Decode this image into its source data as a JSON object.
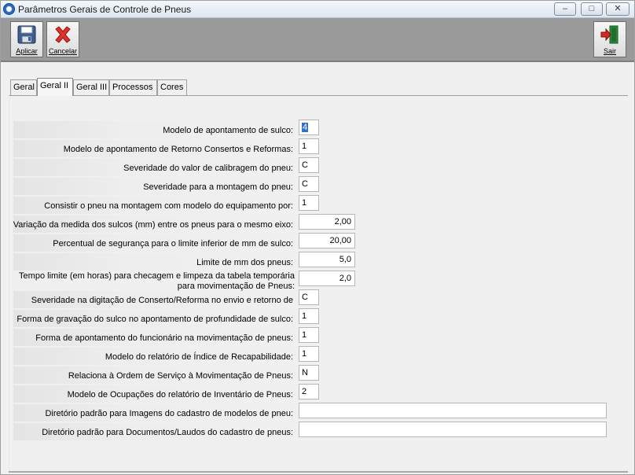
{
  "window": {
    "title": "Parâmetros Gerais de Controle de Pneus",
    "controls": {
      "minimize": "–",
      "maximize": "□",
      "close": "✕"
    }
  },
  "toolbar": {
    "aplicar_label": "Aplicar",
    "cancelar_label": "Cancelar",
    "sair_label": "Sair"
  },
  "tabs": [
    "Geral",
    "Geral II",
    "Geral III",
    "Processos",
    "Cores"
  ],
  "active_tab": "Geral II",
  "fields": [
    {
      "label": "Modelo de apontamento de sulco:",
      "value": "4"
    },
    {
      "label": "Modelo de apontamento de Retorno Consertos e Reformas:",
      "value": "1"
    },
    {
      "label": "Severidade do valor de calibragem do pneu:",
      "value": "C"
    },
    {
      "label": "Severidade para a montagem do pneu:",
      "value": "C"
    },
    {
      "label": "Consistir o pneu na montagem com modelo do equipamento por:",
      "value": "1"
    },
    {
      "label": "Variação da medida dos sulcos (mm) entre os pneus para o mesmo eixo:",
      "value": "2,00"
    },
    {
      "label": "Percentual de segurança para o limite inferior de mm de sulco:",
      "value": "20,00"
    },
    {
      "label": "Limite de mm dos pneus:",
      "value": "5,0"
    },
    {
      "label": "Tempo limite (em horas) para checagem e limpeza da tabela temporária para movimentação de Pneus:",
      "value": "2,0"
    },
    {
      "label": "Severidade na digitação de Conserto/Reforma no envio e retorno de",
      "value": "C"
    },
    {
      "label": "Forma de gravação do sulco no apontamento de profundidade de sulco:",
      "value": "1"
    },
    {
      "label": "Forma de apontamento do funcionário na movimentação de pneus:",
      "value": "1"
    },
    {
      "label": "Modelo do relatório de Índice de Recapabilidade:",
      "value": "1"
    },
    {
      "label": "Relaciona à Ordem de Serviço à Movimentação de Pneus:",
      "value": "N"
    },
    {
      "label": "Modelo de Ocupações do relatório de Inventário de Pneus:",
      "value": "2"
    },
    {
      "label": "Diretório padrão para Imagens do cadastro de modelos de pneu:",
      "value": ""
    },
    {
      "label": "Diretório padrão para Documentos/Laudos do cadastro de pneus:",
      "value": ""
    }
  ]
}
